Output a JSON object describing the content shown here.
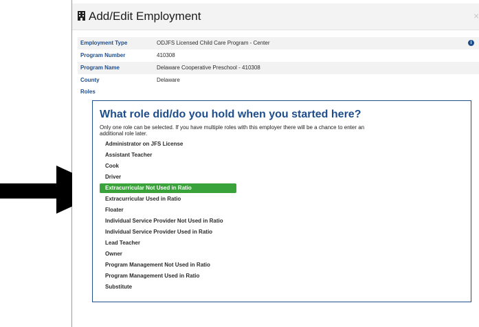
{
  "modal": {
    "title": "Add/Edit Employment",
    "close_label": "×"
  },
  "details": [
    {
      "label": "Employment Type",
      "value": "ODJFS Licensed Child Care Program - Center"
    },
    {
      "label": "Program Number",
      "value": "410308"
    },
    {
      "label": "Program Name",
      "value": "Delaware Cooperative Preschool - 410308"
    },
    {
      "label": "County",
      "value": "Delaware"
    }
  ],
  "info_icon_label": "i",
  "roles_label": "Roles",
  "question": "What role did/do you hold when you started here?",
  "help_text": "Only one role can be selected. If you have multiple roles with this employer there will be a chance to enter an additional role later.",
  "roles": [
    "Administrator on JFS License",
    "Assistant Teacher",
    "Cook",
    "Driver",
    "Extracurricular Not Used in Ratio",
    "Extracurricular Used in Ratio",
    "Floater",
    "Individual Service Provider Not Used in Ratio",
    "Individual Service Provider Used in Ratio",
    "Lead Teacher",
    "Owner",
    "Program Management Not Used in Ratio",
    "Program Management Used in Ratio",
    "Substitute"
  ],
  "selected_role": "Extracurricular Not Used in Ratio",
  "colors": {
    "accent": "#1e4d8c",
    "selected": "#3aa23a",
    "arrow": "#000000"
  },
  "icons": {
    "title": "building-icon",
    "info": "info-icon",
    "pointer": "arrow-right-icon"
  }
}
